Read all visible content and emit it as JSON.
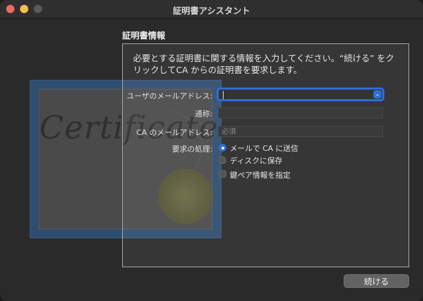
{
  "window": {
    "title": "証明書アシスタント"
  },
  "section": {
    "heading": "証明書情報"
  },
  "description": "必要とする証明書に関する情報を入力してください。“続ける” をクリックしてCA からの証明書を要求します。",
  "certificate": {
    "script_text": "Certificate"
  },
  "form": {
    "user_email": {
      "label": "ユーザのメールアドレス:",
      "value": "",
      "button_icon": "chevron-down-icon"
    },
    "common_name": {
      "label": "通称:",
      "value": ""
    },
    "ca_email": {
      "label": "CA のメールアドレス:",
      "value": "",
      "placeholder": "必須"
    },
    "request_label": "要求の処理:",
    "options": [
      {
        "label": "メールで CA に送信",
        "selected": true
      },
      {
        "label": "ディスクに保存",
        "selected": false
      }
    ],
    "keypair": {
      "label": "鍵ペア情報を指定",
      "checked": false
    }
  },
  "buttons": {
    "continue": "続ける"
  },
  "colors": {
    "accent": "#2f6fd6",
    "close": "#ed6a5e",
    "minimize": "#f5bf4f"
  }
}
